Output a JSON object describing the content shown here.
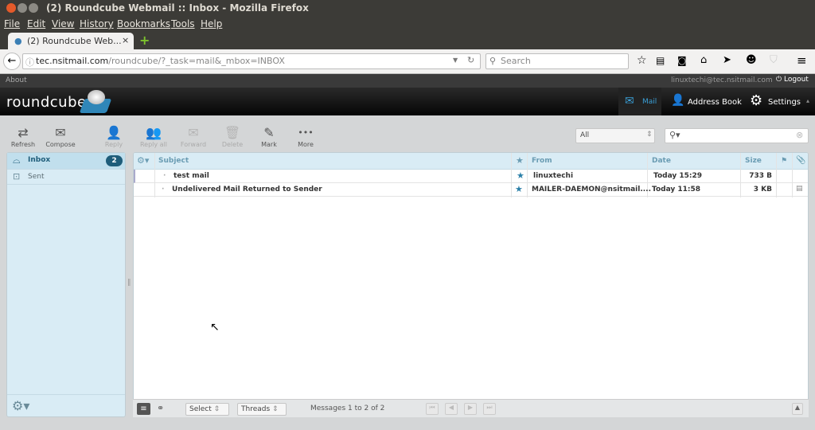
{
  "window": {
    "title": "(2) Roundcube Webmail :: Inbox - Mozilla Firefox"
  },
  "menu": [
    "File",
    "Edit",
    "View",
    "History",
    "Bookmarks",
    "Tools",
    "Help"
  ],
  "tab": {
    "label": "(2) Roundcube Web...",
    "close": "×",
    "new": "+"
  },
  "nav": {
    "url_domain": "tec.nsitmail.com",
    "url_path": "/roundcube/?_task=mail&_mbox=INBOX",
    "search_placeholder": "Search"
  },
  "rc": {
    "about": "About",
    "user": "linuxtechi@tec.nsitmail.com",
    "logout": "Logout",
    "logo": "roundcube",
    "tasks": [
      {
        "label": "Mail",
        "active": true
      },
      {
        "label": "Address Book"
      },
      {
        "label": "Settings"
      }
    ]
  },
  "toolbar": [
    {
      "label": "Refresh",
      "icon": "⇄",
      "enabled": true
    },
    {
      "label": "Compose",
      "icon": "✉",
      "enabled": true
    },
    {
      "label": "Reply",
      "icon": "👤",
      "enabled": false
    },
    {
      "label": "Reply all",
      "icon": "👥",
      "enabled": false
    },
    {
      "label": "Forward",
      "icon": "✉",
      "enabled": false
    },
    {
      "label": "Delete",
      "icon": "🗑",
      "enabled": false
    },
    {
      "label": "Mark",
      "icon": "✎",
      "enabled": true
    },
    {
      "label": "More",
      "icon": "•••",
      "enabled": true
    }
  ],
  "filter": {
    "value": "All"
  },
  "folders": [
    {
      "name": "Inbox",
      "unread": "2",
      "active": true
    },
    {
      "name": "Sent"
    }
  ],
  "columns": {
    "subject": "Subject",
    "from": "From",
    "date": "Date",
    "size": "Size"
  },
  "messages": [
    {
      "subject": "test mail",
      "from": "linuxtechi",
      "date": "Today 15:29",
      "size": "733 B",
      "attachment": false
    },
    {
      "subject": "Undelivered Mail Returned to Sender",
      "from": "MAILER-DAEMON@nsitmail....",
      "date": "Today 11:58",
      "size": "3 KB",
      "attachment": true
    }
  ],
  "footer": {
    "select": "Select",
    "threads": "Threads",
    "count": "Messages 1 to 2 of 2"
  },
  "colors": {
    "accent": "#2a7fa8",
    "header_bg": "#d9ecf5",
    "badge": "#1f5d7a"
  }
}
